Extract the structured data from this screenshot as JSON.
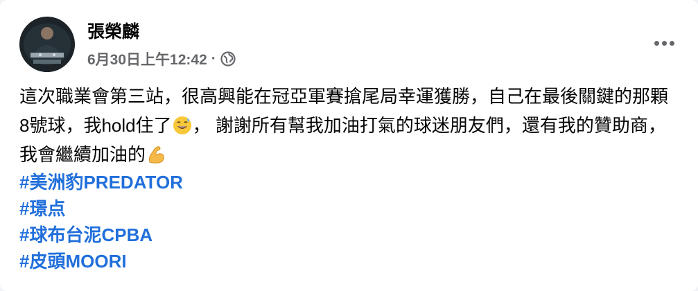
{
  "post": {
    "author": "張榮麟",
    "timestamp": "6月30日上午12:42",
    "separator": "·",
    "privacy_icon": "globe-icon",
    "more_icon": "more-options-icon",
    "text_part1": "這次職業會第三站，很高興能在冠亞軍賽搶尾局幸運獲勝，自己在最後關鍵的那顆8號球，我hold住了",
    "emoji1": "grinning-sweat-emoji",
    "text_part2": "， 謝謝所有幫我加油打氣的球迷朋友們，還有我的贊助商，我會繼續加油的",
    "emoji2": "flexed-biceps-emoji",
    "hashtags": [
      "#美洲豹PREDATOR",
      "#璟点",
      "#球布台泥CPBA",
      "#皮頭MOORI"
    ]
  },
  "colors": {
    "hashtag": "#216fdb",
    "meta_text": "#65676b",
    "primary_text": "#050505"
  }
}
